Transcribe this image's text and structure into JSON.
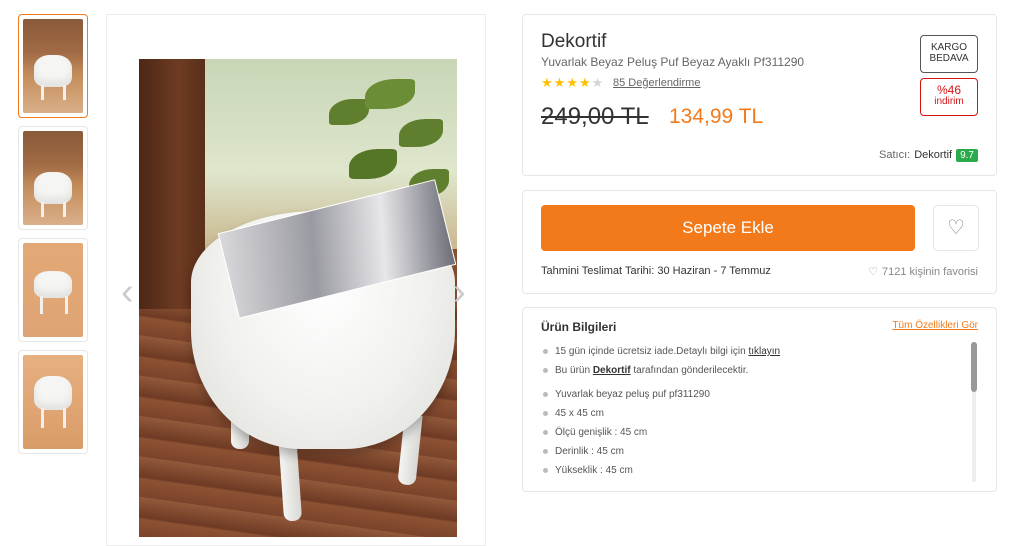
{
  "gallery": {
    "prev_arrow": "‹",
    "next_arrow": "›"
  },
  "product": {
    "brand": "Dekortif",
    "title": "Yuvarlak Beyaz Peluş Puf Beyaz Ayaklı Pf311290",
    "rating": 4,
    "rating_max": 5,
    "review_link": "85 Değerlendirme",
    "old_price": "249,00 TL",
    "new_price": "134,99 TL",
    "badge_cargo_line1": "KARGO",
    "badge_cargo_line2": "BEDAVA",
    "badge_discount_pct": "%46",
    "badge_discount_label": "indirim",
    "seller_label": "Satıcı:",
    "seller_name": "Dekortif",
    "seller_score": "9.7"
  },
  "actions": {
    "add_to_cart": "Sepete Ekle",
    "delivery": "Tahmini Teslimat Tarihi: 30 Haziran - 7 Temmuz",
    "favorites": "7121 kişinin favorisi"
  },
  "info": {
    "title": "Ürün Bilgileri",
    "all_features": "Tüm Özellikleri Gör",
    "return_text": "15 gün içinde ücretsiz iade.Detaylı bilgi için ",
    "return_link": "tıklayın",
    "seller_text_pre": "Bu ürün ",
    "seller_text_brand": "Dekortif",
    "seller_text_post": " tarafından gönderilecektir.",
    "features": [
      "Yuvarlak beyaz peluş puf pf311290",
      "45 x 45 cm",
      "Ölçü genişlik : 45 cm",
      "Derinlik : 45 cm",
      "Yükseklik : 45 cm"
    ]
  },
  "colors": {
    "accent": "#f27a1a",
    "discount": "#d21313",
    "seller_score": "#2aaa4a"
  }
}
